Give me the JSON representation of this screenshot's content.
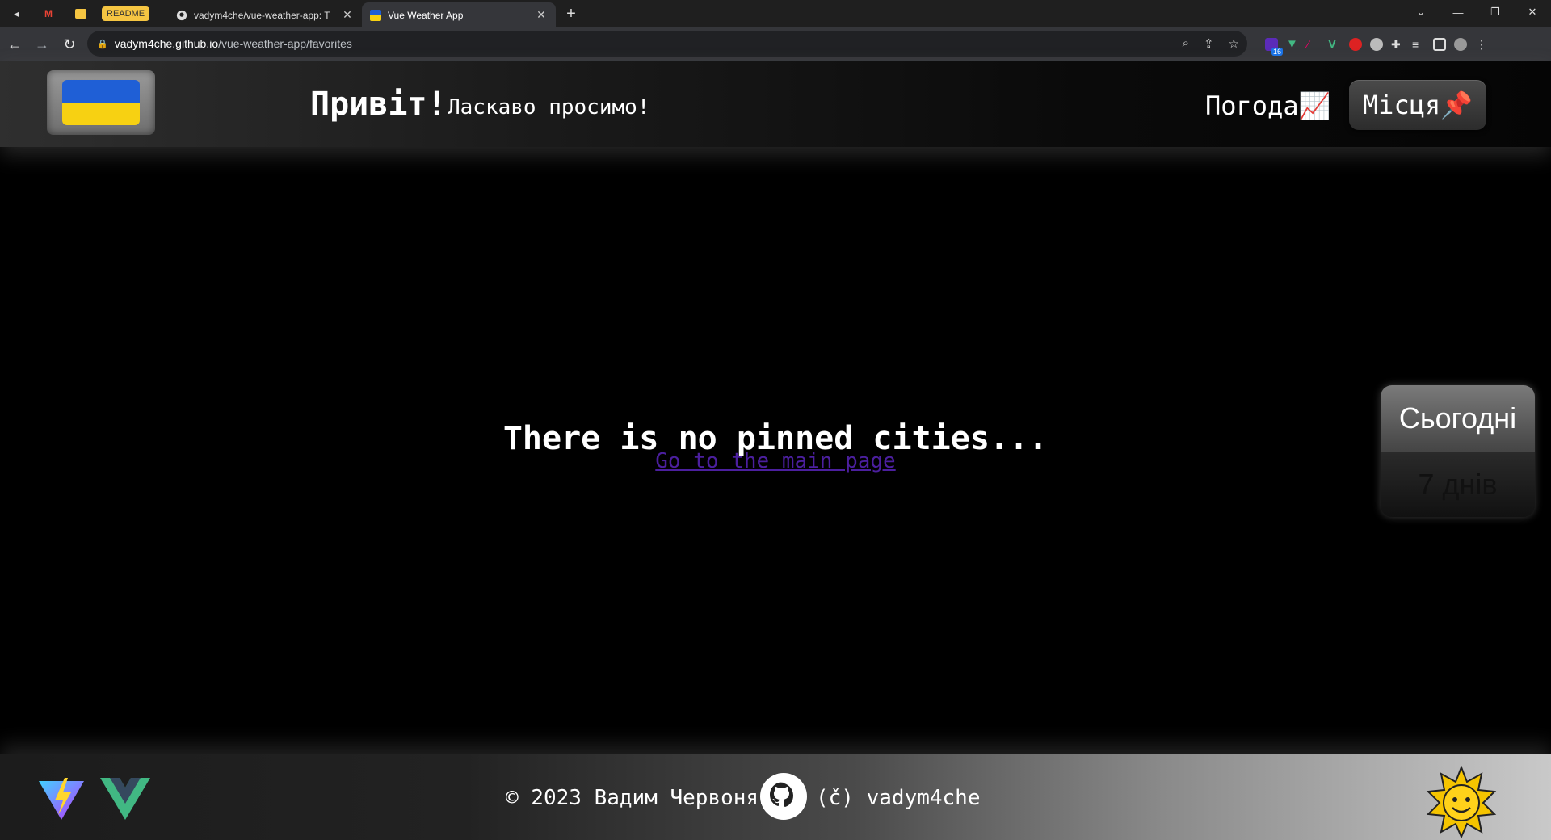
{
  "browser": {
    "pinned_badge": "README",
    "tabs": [
      {
        "title": "vadym4che/vue-weather-app: T",
        "active": false
      },
      {
        "title": "Vue Weather App",
        "active": true
      }
    ],
    "url": {
      "host": "vadym4che.github.io",
      "path": "/vue-weather-app/favorites"
    },
    "extension_badge": "16"
  },
  "header": {
    "greeting": "Привіт!",
    "welcome": "Ласкаво просимо!",
    "nav": {
      "weather": "Погода📈",
      "places": "Місця📌"
    }
  },
  "main": {
    "empty_message": "There is no pinned cities...",
    "main_link": "Go to the main page"
  },
  "side_panel": {
    "today": "Сьогодні",
    "week": "7 днів"
  },
  "footer": {
    "copyright": "© 2023 Вадим Червоняк",
    "handle": "(č) vadym4che"
  },
  "colors": {
    "flag_blue": "#1f5fd6",
    "flag_yellow": "#f7d112",
    "link": "#4b1f9e"
  }
}
